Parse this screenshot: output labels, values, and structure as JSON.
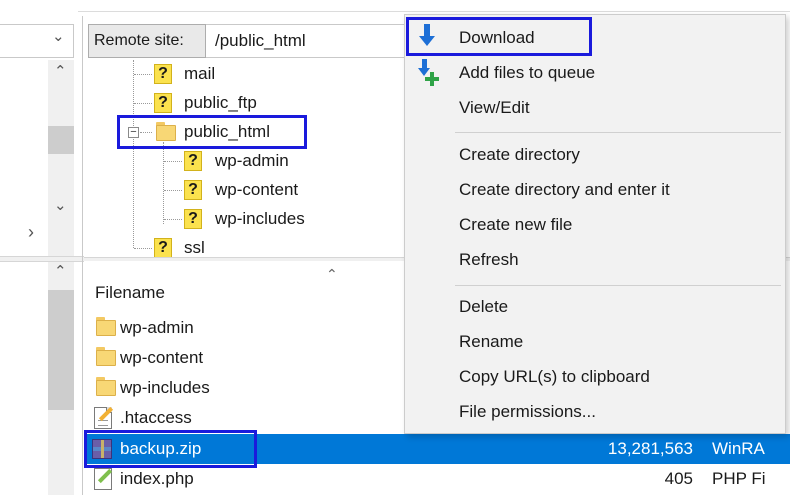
{
  "remote": {
    "label": "Remote site:",
    "path": "/public_html"
  },
  "tree": {
    "items": [
      {
        "label": "mail",
        "icon": "question-folder-icon"
      },
      {
        "label": "public_ftp",
        "icon": "question-folder-icon"
      },
      {
        "label": "public_html",
        "icon": "folder-icon"
      },
      {
        "label": "wp-admin",
        "icon": "question-folder-icon"
      },
      {
        "label": "wp-content",
        "icon": "question-folder-icon"
      },
      {
        "label": "wp-includes",
        "icon": "question-folder-icon"
      },
      {
        "label": "ssl",
        "icon": "question-folder-icon"
      }
    ],
    "collapse_symbol": "−"
  },
  "filelist": {
    "header": "Filename",
    "rows": [
      {
        "name": "wp-admin",
        "size": "",
        "type": "",
        "icon": "folder-icon"
      },
      {
        "name": "wp-content",
        "size": "",
        "type": "",
        "icon": "folder-icon"
      },
      {
        "name": "wp-includes",
        "size": "",
        "type": "",
        "icon": "folder-icon"
      },
      {
        "name": ".htaccess",
        "size": "",
        "type": "",
        "icon": "text-file-icon"
      },
      {
        "name": "backup.zip",
        "size": "13,281,563",
        "type": "WinRA",
        "icon": "zip-archive-icon"
      },
      {
        "name": "index.php",
        "size": "405",
        "type": "PHP Fi",
        "icon": "php-file-icon"
      }
    ]
  },
  "menu": {
    "items": [
      "Download",
      "Add files to queue",
      "View/Edit",
      "Create directory",
      "Create directory and enter it",
      "Create new file",
      "Refresh",
      "Delete",
      "Rename",
      "Copy URL(s) to clipboard",
      "File permissions..."
    ]
  },
  "glyphs": {
    "question": "?",
    "chevron_down": "⌄",
    "chevron_up": "⌃",
    "chevron_right": "›"
  },
  "colors": {
    "selection": "#0078d7",
    "highlight_box": "#1a1adc",
    "download_arrow": "#1d6fd6"
  }
}
